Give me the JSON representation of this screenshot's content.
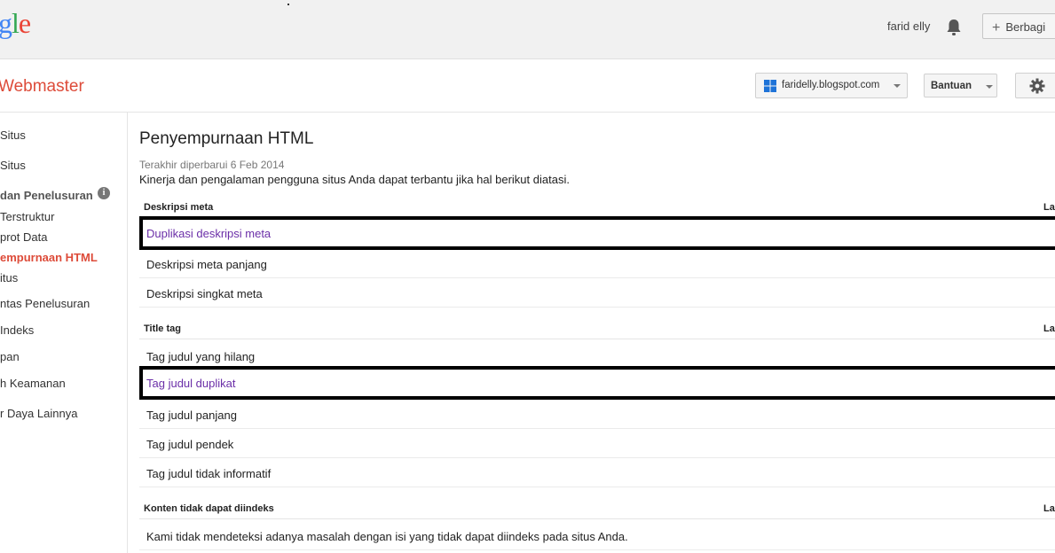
{
  "header": {
    "logo_text": "gle",
    "username": "farid elly",
    "share_label": "Berbagi",
    "bell_icon": "bell-icon"
  },
  "subheader": {
    "product_name": "Webmaster",
    "site": "faridelly.blogspot.com",
    "help_label": "Bantuan"
  },
  "sidebar": {
    "items": [
      {
        "label": "Situs",
        "type": "item"
      },
      {
        "label": "Situs",
        "type": "item"
      },
      {
        "label": "dan Penelusuran",
        "type": "section"
      },
      {
        "label": "Terstruktur",
        "type": "item"
      },
      {
        "label": "prot Data",
        "type": "item"
      },
      {
        "label": "empurnaan HTML",
        "type": "active"
      },
      {
        "label": "itus",
        "type": "item"
      },
      {
        "label": "ntas Penelusuran",
        "type": "item"
      },
      {
        "label": "Indeks",
        "type": "item"
      },
      {
        "label": "pan",
        "type": "item"
      },
      {
        "label": "h Keamanan",
        "type": "item"
      },
      {
        "label": "r Daya Lainnya",
        "type": "item"
      }
    ]
  },
  "main": {
    "title": "Penyempurnaan HTML",
    "updated": "Terakhir diperbarui 6 Feb 2014",
    "description": "Kinerja dan pengalaman pengguna situs Anda dapat terbantu jika hal berikut diatasi.",
    "groups": [
      {
        "name": "Deskripsi meta",
        "col": "La",
        "rows": [
          {
            "label": "Duplikasi deskripsi meta",
            "link": true,
            "boxed": true
          },
          {
            "label": "Deskripsi meta panjang",
            "link": false,
            "boxed": false
          },
          {
            "label": "Deskripsi singkat meta",
            "link": false,
            "boxed": false
          }
        ]
      },
      {
        "name": "Title tag",
        "col": "La",
        "rows": [
          {
            "label": "Tag judul yang hilang",
            "link": false,
            "boxed": false
          },
          {
            "label": "Tag judul duplikat",
            "link": true,
            "boxed": true
          },
          {
            "label": "Tag judul panjang",
            "link": false,
            "boxed": false
          },
          {
            "label": "Tag judul pendek",
            "link": false,
            "boxed": false
          },
          {
            "label": "Tag judul tidak informatif",
            "link": false,
            "boxed": false
          }
        ]
      },
      {
        "name": "Konten tidak dapat diindeks",
        "col": "La",
        "rows": [
          {
            "label": "Kami tidak mendeteksi adanya masalah dengan isi yang tidak dapat diindeks pada situs Anda.",
            "link": false,
            "boxed": false
          }
        ]
      }
    ]
  }
}
